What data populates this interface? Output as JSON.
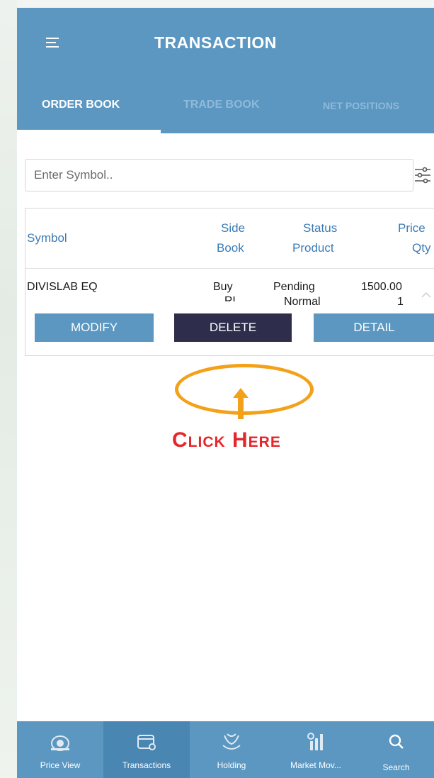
{
  "header": {
    "title": "TRANSACTION",
    "tabs": [
      {
        "label": "ORDER BOOK",
        "active": true
      },
      {
        "label": "TRADE BOOK",
        "active": false
      },
      {
        "label": "NET POSITIONS",
        "active": false
      }
    ]
  },
  "search": {
    "placeholder": "Enter Symbol..",
    "value": ""
  },
  "table": {
    "headers": {
      "symbol": "Symbol",
      "side": "Side",
      "book": "Book",
      "status": "Status",
      "product": "Product",
      "price": "Price",
      "qty": "Qty"
    },
    "rows": [
      {
        "symbol": "DIVISLAB EQ",
        "side": "Buy",
        "book": "RL",
        "status": "Pending",
        "product": "Normal",
        "price": "1500.00",
        "qty": "1"
      }
    ],
    "actions": {
      "modify": "MODIFY",
      "delete": "DELETE",
      "detail": "DETAIL"
    }
  },
  "bottom_nav": [
    {
      "label": "Price View",
      "icon": "price-view-icon",
      "active": false
    },
    {
      "label": "Transactions",
      "icon": "transactions-icon",
      "active": true
    },
    {
      "label": "Holding",
      "icon": "holding-icon",
      "active": false
    },
    {
      "label": "Market Mov...",
      "icon": "market-movers-icon",
      "active": false
    },
    {
      "label": "Search",
      "icon": "search-icon",
      "active": false
    }
  ],
  "annotation": {
    "text": "Click Here"
  },
  "colors": {
    "primary": "#5b97c1",
    "delete_button": "#2e2d4c",
    "header_text": "#3c7bb5",
    "annotation_orange": "#f4a11a",
    "annotation_red": "#e4272b"
  }
}
